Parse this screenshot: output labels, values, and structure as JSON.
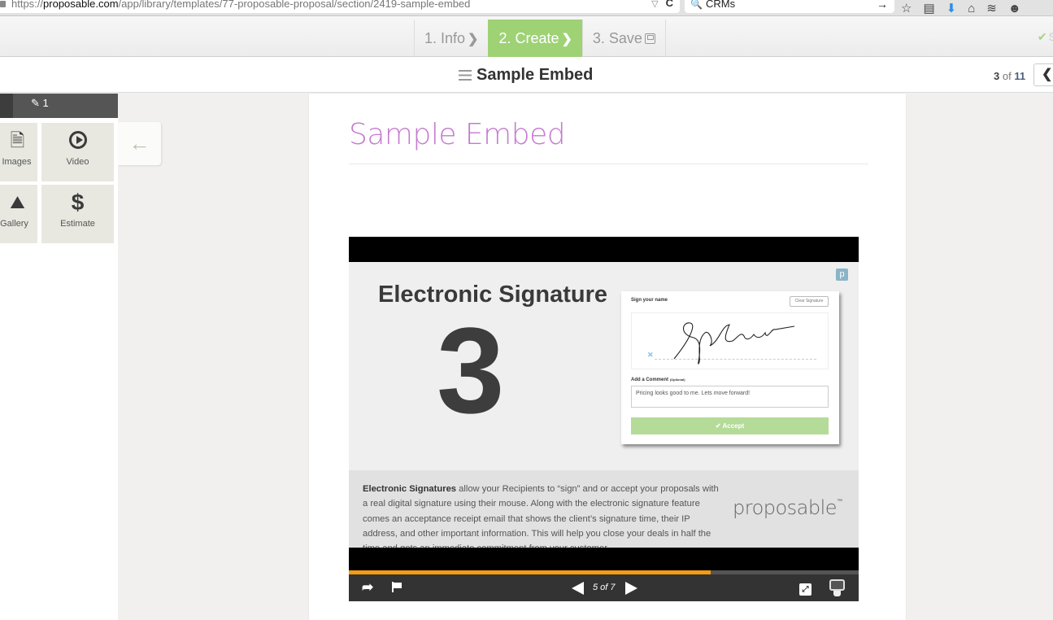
{
  "browser": {
    "url_scheme": "https://",
    "url_host": "proposable.com",
    "url_path": "/app/library/templates/77-proposable-proposal/section/2419-sample-embed",
    "search_value": "CRMs",
    "dropdown_glyph": "▽",
    "reload_glyph": "C",
    "search_glyph": "🔍",
    "go_glyph": "→",
    "icons": [
      "☆",
      "▤",
      "⬇",
      "⌂",
      "≋",
      "☻"
    ]
  },
  "steps": [
    {
      "label": "1. Info",
      "state": "done"
    },
    {
      "label": "2. Create",
      "state": "active"
    },
    {
      "label": "3. Save",
      "state": "pending"
    }
  ],
  "step_chevron": "❯",
  "saved_indicator": {
    "icon": "✔",
    "text": "S"
  },
  "section": {
    "title": "Sample Embed",
    "current": "3",
    "of_label": "of",
    "total": "11",
    "prev_glyph": "❮"
  },
  "left_panel": {
    "tab_count": "1",
    "tab_icon": "✎",
    "tiles": [
      {
        "label": "Images",
        "icon": "document-icon"
      },
      {
        "label": "Video",
        "icon": "play-circle-icon"
      },
      {
        "label": "Gallery",
        "icon": "image-icon"
      },
      {
        "label": "Estimate",
        "icon": "dollar-icon"
      }
    ],
    "estimate_glyph": "$",
    "images_glyph": "🗎",
    "gallery_glyph": "⛰",
    "collapse_glyph": "🡐"
  },
  "page": {
    "heading": "Sample Embed"
  },
  "embed": {
    "slide_title": "Electronic Signature",
    "slide_number": "3",
    "badge": "p",
    "signature_card": {
      "sign_label": "Sign your name",
      "clear_label": "Clear Signature",
      "comment_label": "Add a Comment",
      "comment_optional": "(Optional)",
      "comment_value": "Pricing looks good to me. Lets move forward!",
      "accept_label": "✔ Accept",
      "x_mark": "✕"
    },
    "desc_bold": "Electronic Signatures",
    "desc_text": " allow your Recipients to “sign” and or accept your proposals with a real digital signature using their mouse. Along with the electronic signature feature comes an acceptance receipt email that shows the client’s signature time, their IP address, and other important information. This will help you close your deals in half the time and gets an immediate commitment from your customer.",
    "brand": "proposable",
    "brand_tm": "™",
    "progress_fraction": 0.71,
    "current_slide": 5,
    "total_slides": 7,
    "counter": "5 of 7",
    "share_glyph": "➦",
    "fullscreen_glyph": "⤢",
    "colors": {
      "progress": "#f39c12",
      "accent_green": "#9ed275",
      "heading_purple": "#c57ad0"
    }
  }
}
